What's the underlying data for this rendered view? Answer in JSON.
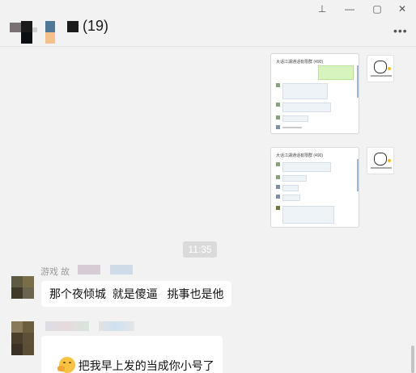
{
  "window": {
    "pin_icon": "pin-icon",
    "minimize_icon": "minimize-icon",
    "maximize_icon": "maximize-icon",
    "close_icon": "close-icon",
    "pin_glyph": "⊥",
    "minimize_glyph": "—",
    "maximize_glyph": "▢",
    "close_glyph": "✕"
  },
  "header": {
    "member_count": "(19)",
    "more_glyph": "•••"
  },
  "screenshot1": {
    "title": "大话江湖通话有限群 (490)"
  },
  "screenshot2": {
    "title": "大话江湖通话有限群 (490)"
  },
  "divider": {
    "time": "11:35"
  },
  "messages": [
    {
      "sender": "游戏 故",
      "text": "那个夜倾城  就是傻逼   挑事也是他"
    },
    {
      "sender": "",
      "emoji": "hugging-face-icon",
      "text": "把我早上发的当成你小号了"
    }
  ],
  "colors": {
    "background": "#f2f2f2",
    "bubble": "#ffffff",
    "time_pill": "#dadada"
  }
}
